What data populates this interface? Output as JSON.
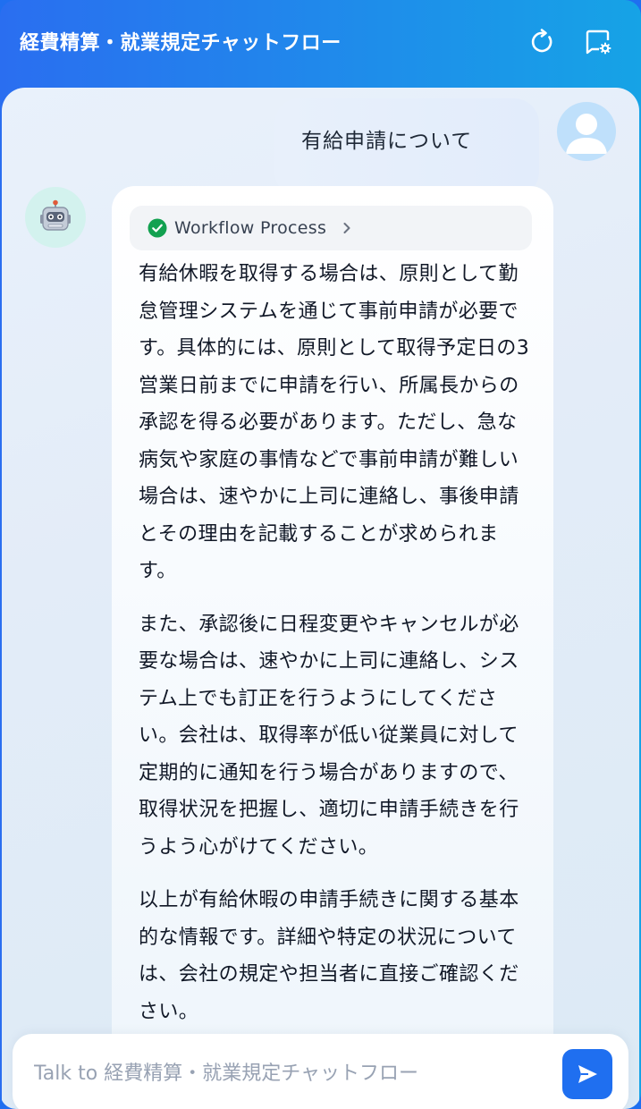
{
  "header": {
    "title": "経費精算・就業規定チャットフロー"
  },
  "user_message": {
    "text": "有給申請について"
  },
  "bot_message": {
    "workflow_label": "Workflow Process",
    "paragraphs": [
      "有給休暇を取得する場合は、原則として勤怠管理システムを通じて事前申請が必要です。具体的には、原則として取得予定日の3営業日前までに申請を行い、所属長からの承認を得る必要があります。ただし、急な病気や家庭の事情などで事前申請が難しい場合は、速やかに上司に連絡し、事後申請とその理由を記載することが求められます。",
      "また、承認後に日程変更やキャンセルが必要な場合は、速やかに上司に連絡し、システム上でも訂正を行うようにしてください。会社は、取得率が低い従業員に対して定期的に通知を行う場合がありますので、取得状況を把握し、適切に申請手続きを行うよう心がけてください。",
      "以上が有給休暇の申請手続きに関する基本的な情報です。詳細や特定の状況については、会社の規定や担当者に直接ご確認ください。"
    ]
  },
  "input": {
    "placeholder": "Talk to 経費精算・就業規定チャットフロー",
    "value": ""
  },
  "icons": {
    "refresh": "refresh-icon",
    "settings": "chat-settings-icon",
    "bot": "robot-icon",
    "user": "user-icon",
    "check": "check-circle-icon",
    "chevron": "chevron-right-icon",
    "send": "send-icon"
  },
  "colors": {
    "accent": "#1f6ff0",
    "check": "#12a150"
  }
}
